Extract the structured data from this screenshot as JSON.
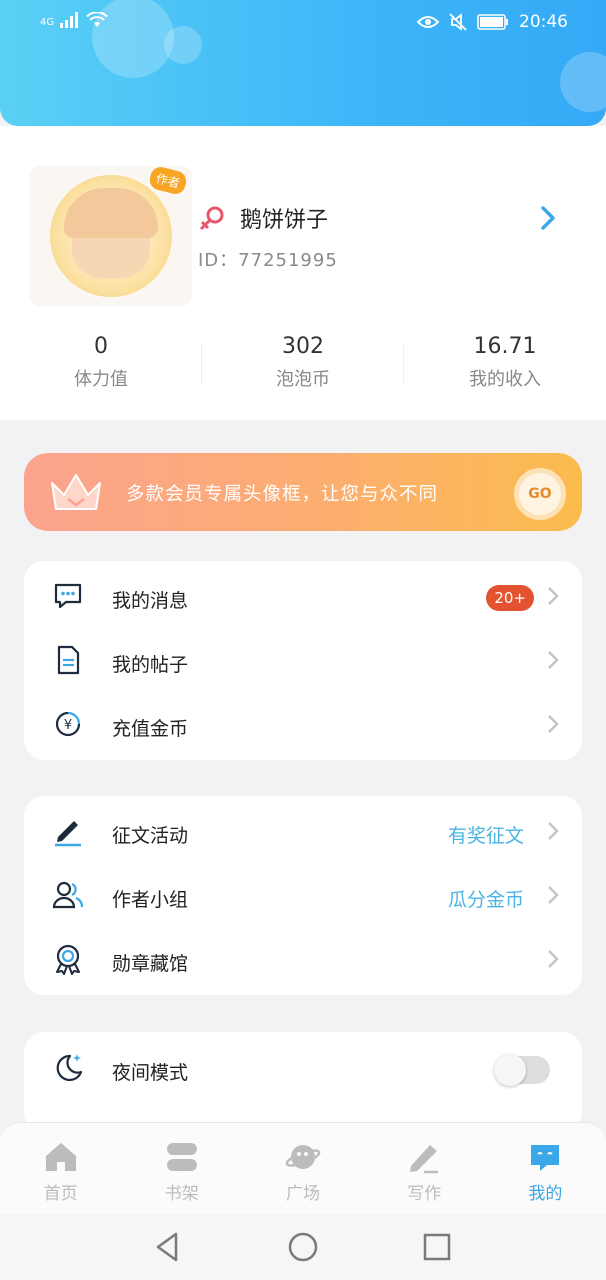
{
  "status_bar": {
    "network": "4G",
    "time": "20:46"
  },
  "profile": {
    "avatar_badge": "作者",
    "username": "鹅饼饼子",
    "user_id": "ID：77251995",
    "stats": [
      {
        "value": "0",
        "label": "体力值"
      },
      {
        "value": "302",
        "label": "泡泡币"
      },
      {
        "value": "16.71",
        "label": "我的收入"
      }
    ]
  },
  "vip_banner": {
    "text": "多款会员专属头像框，让您与众不同",
    "go_label": "GO"
  },
  "card1": {
    "items": [
      {
        "label": "我的消息",
        "badge": "20+",
        "icon": "message-icon"
      },
      {
        "label": "我的帖子",
        "icon": "document-icon"
      },
      {
        "label": "充值金币",
        "icon": "coin-icon"
      }
    ]
  },
  "card2": {
    "items": [
      {
        "label": "征文活动",
        "extra": "有奖征文",
        "icon": "pen-icon"
      },
      {
        "label": "作者小组",
        "extra": "瓜分金币",
        "icon": "group-icon"
      },
      {
        "label": "勋章藏馆",
        "icon": "medal-icon"
      }
    ]
  },
  "card3": {
    "items": [
      {
        "label": "夜间模式",
        "icon": "moon-icon",
        "toggle_on": false
      }
    ]
  },
  "bottom_nav": {
    "items": [
      {
        "label": "首页",
        "icon": "home-icon"
      },
      {
        "label": "书架",
        "icon": "bookshelf-icon"
      },
      {
        "label": "广场",
        "icon": "planet-icon"
      },
      {
        "label": "写作",
        "icon": "write-icon"
      },
      {
        "label": "我的",
        "icon": "profile-chat-icon",
        "active": true
      }
    ]
  },
  "colors": {
    "accent": "#3aa8e8",
    "badge": "#e4532f",
    "header_start": "#5ad0f5",
    "header_end": "#35a9f6"
  }
}
